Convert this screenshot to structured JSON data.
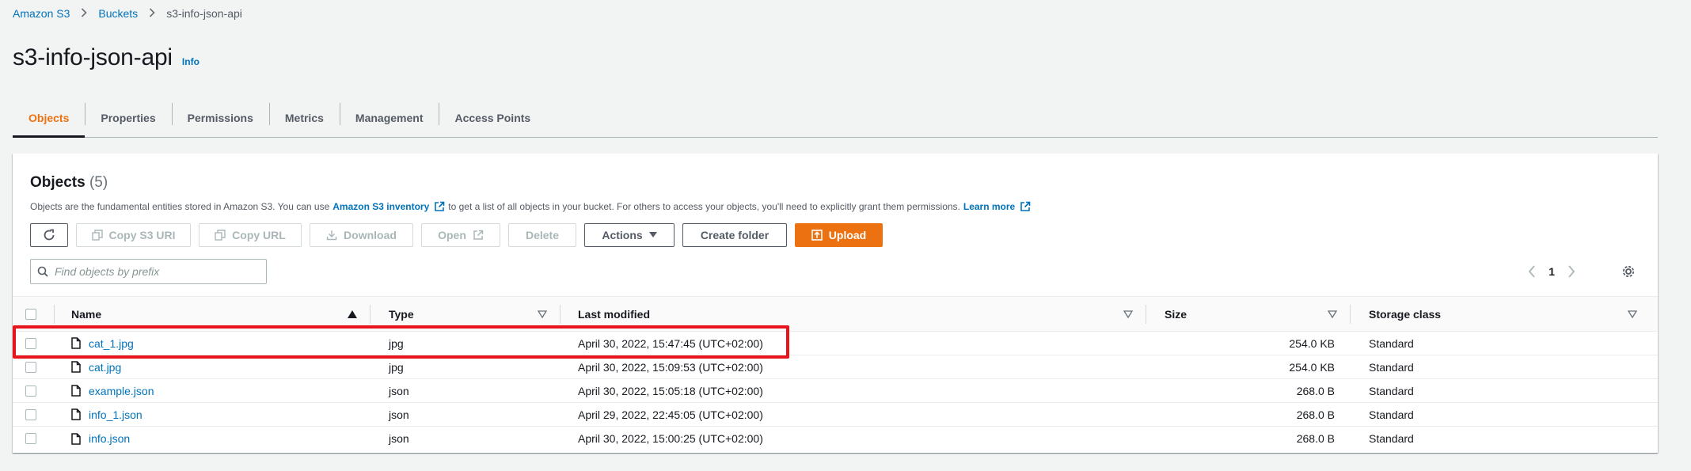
{
  "breadcrumb": {
    "items": [
      "Amazon S3",
      "Buckets"
    ],
    "current": "s3-info-json-api"
  },
  "header": {
    "title": "s3-info-json-api",
    "info_label": "Info"
  },
  "tabs": [
    {
      "label": "Objects",
      "active": true
    },
    {
      "label": "Properties",
      "active": false
    },
    {
      "label": "Permissions",
      "active": false
    },
    {
      "label": "Metrics",
      "active": false
    },
    {
      "label": "Management",
      "active": false
    },
    {
      "label": "Access Points",
      "active": false
    }
  ],
  "objects_panel": {
    "title": "Objects",
    "count": "(5)",
    "description_pre": "Objects are the fundamental entities stored in Amazon S3. You can use",
    "inventory_link": "Amazon S3 inventory",
    "description_mid": "to get a list of all objects in your bucket. For others to access your objects, you'll need to explicitly grant them permissions.",
    "learn_more": "Learn more"
  },
  "toolbar": {
    "copy_s3_uri": "Copy S3 URI",
    "copy_url": "Copy URL",
    "download": "Download",
    "open": "Open",
    "delete": "Delete",
    "actions": "Actions",
    "create_folder": "Create folder",
    "upload": "Upload"
  },
  "search": {
    "placeholder": "Find objects by prefix",
    "value": ""
  },
  "pagination": {
    "current_page": "1"
  },
  "table": {
    "columns": {
      "name": "Name",
      "type": "Type",
      "last_modified": "Last modified",
      "size": "Size",
      "storage_class": "Storage class"
    },
    "rows": [
      {
        "name": "cat_1.jpg",
        "type": "jpg",
        "last_modified": "April 30, 2022, 15:47:45 (UTC+02:00)",
        "size": "254.0 KB",
        "storage_class": "Standard"
      },
      {
        "name": "cat.jpg",
        "type": "jpg",
        "last_modified": "April 30, 2022, 15:09:53 (UTC+02:00)",
        "size": "254.0 KB",
        "storage_class": "Standard"
      },
      {
        "name": "example.json",
        "type": "json",
        "last_modified": "April 30, 2022, 15:05:18 (UTC+02:00)",
        "size": "268.0 B",
        "storage_class": "Standard"
      },
      {
        "name": "info_1.json",
        "type": "json",
        "last_modified": "April 29, 2022, 22:45:05 (UTC+02:00)",
        "size": "268.0 B",
        "storage_class": "Standard"
      },
      {
        "name": "info.json",
        "type": "json",
        "last_modified": "April 30, 2022, 15:00:25 (UTC+02:00)",
        "size": "268.0 B",
        "storage_class": "Standard"
      }
    ]
  },
  "colors": {
    "accent_orange": "#ec7211",
    "link_blue": "#0073bb",
    "highlight_red": "#e8141b"
  }
}
